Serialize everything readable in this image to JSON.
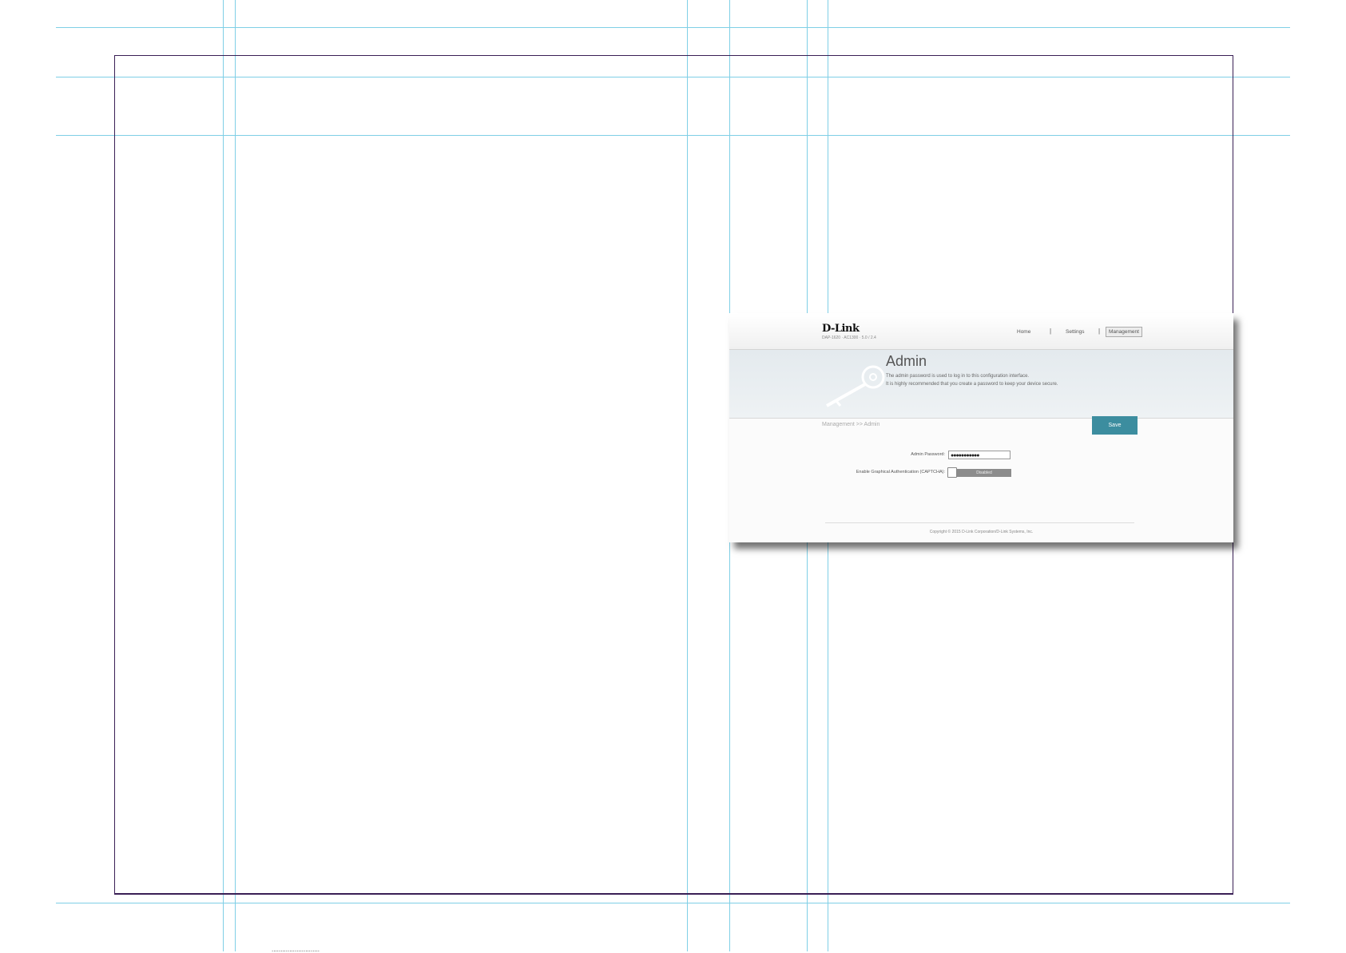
{
  "router": {
    "brand": "D-Link",
    "model": "DAP-1620 · AC1300 · 5.0 / 2.4",
    "nav": [
      "Home",
      "Settings",
      "Management"
    ],
    "nav_separator": "|",
    "active_nav": "Management",
    "page_title": "Admin",
    "description": [
      "The admin password is used to log in to this configuration interface.",
      "It is highly recommended that you create a password to keep your device secure."
    ],
    "breadcrumb": "Management >> Admin",
    "save_label": "Save",
    "admin_password_label": "Admin Password:",
    "admin_password_value": "●●●●●●●●●●●",
    "captcha_label": "Enable Graphical Authentication (CAPTCHA):",
    "captcha_state": "Disabled",
    "copyright": "Copyright © 2015 D-Link Corporation/D-Link Systems, Inc."
  },
  "slug_text": "...........................",
  "colors": {
    "guide_line": "#7fcfe6",
    "page_frame": "#3a1f55",
    "save_button": "#3c8d9f",
    "toggle_track": "#8c8c8c"
  }
}
